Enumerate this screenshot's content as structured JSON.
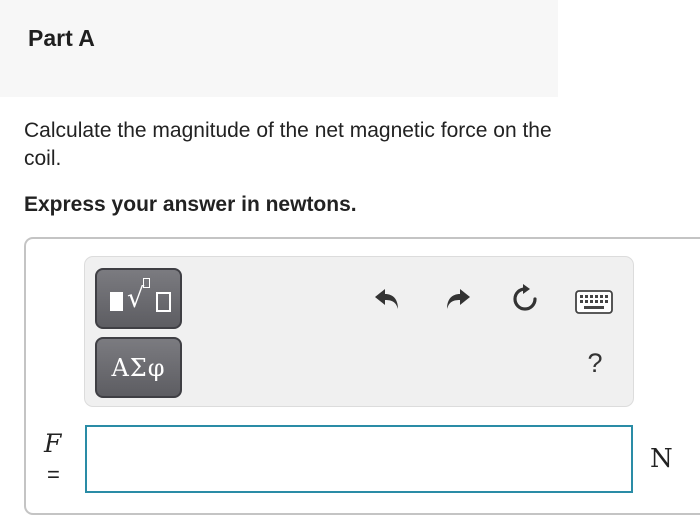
{
  "part": {
    "title": "Part A"
  },
  "question": {
    "text": "Calculate the magnitude of the net magnetic force on the coil.",
    "instruction": "Express your answer in newtons."
  },
  "toolbar": {
    "templates_icon": "fraction-sqrt-template-icon",
    "symbols_label": "ΑΣφ",
    "undo_icon": "undo-arrow-icon",
    "redo_icon": "redo-arrow-icon",
    "reset_icon": "reset-icon",
    "keyboard_icon": "keyboard-icon",
    "help_label": "?"
  },
  "answer": {
    "variable": "F",
    "equals": "=",
    "value": "",
    "unit": "N"
  },
  "colors": {
    "header_bg": "#f7f7f7",
    "toolbar_bg": "#f0f0f0",
    "button_dark": "#5d5d62",
    "input_border": "#2a8ca6"
  }
}
